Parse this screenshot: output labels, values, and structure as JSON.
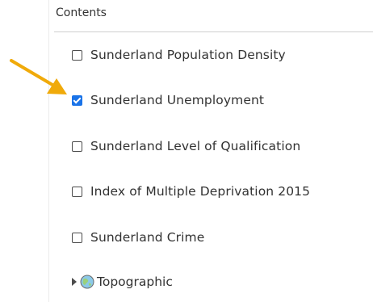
{
  "panel": {
    "header": "Contents"
  },
  "layers": [
    {
      "label": "Sunderland Population Density",
      "checked": false
    },
    {
      "label": "Sunderland Unemployment",
      "checked": true
    },
    {
      "label": "Sunderland Level of Qualification",
      "checked": false
    },
    {
      "label": "Index of Multiple Deprivation 2015",
      "checked": false
    },
    {
      "label": "Sunderland Crime",
      "checked": false
    }
  ],
  "basemap": {
    "label": "Topographic",
    "icon": "globe-icon"
  },
  "annotation": {
    "icon": "arrow-pointer-icon",
    "color": "#f0aa0a"
  },
  "colors": {
    "checkbox_checked": "#1a73e8",
    "text": "#323232"
  }
}
